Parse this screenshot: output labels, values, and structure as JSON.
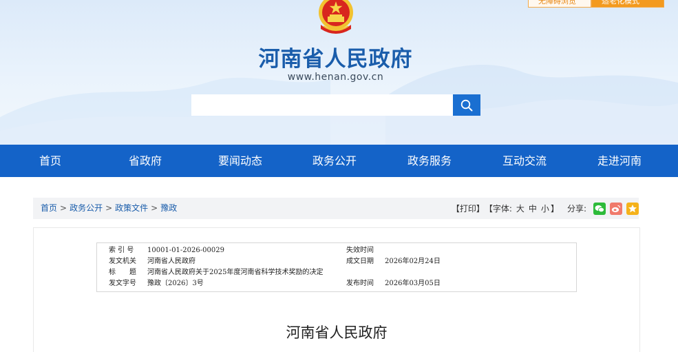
{
  "header": {
    "top_buttons": [
      "无障碍浏览",
      "适老化模式"
    ],
    "site_title": "河南省人民政府",
    "site_url": "www.henan.gov.cn",
    "search": {
      "placeholder": ""
    }
  },
  "nav": [
    "首页",
    "省政府",
    "要闻动态",
    "政务公开",
    "政务服务",
    "互动交流",
    "走进河南"
  ],
  "breadcrumb": {
    "items": [
      "首页",
      "政务公开",
      "政策文件",
      "豫政"
    ],
    "separator": ">"
  },
  "tools": {
    "print": "【打印】",
    "font_label": "【字体:",
    "font_large": "大",
    "font_medium": "中",
    "font_small": "小",
    "font_close": "】",
    "share_label": "分享:",
    "share_icons": [
      "wechat-icon",
      "weibo-icon",
      "favorite-icon"
    ]
  },
  "meta": {
    "index_label": "索 引 号",
    "index_value": "10001-01-2026-00029",
    "expire_label": "失效时间",
    "expire_value": "",
    "issuer_label": "发文机关",
    "issuer_value": "河南省人民政府",
    "created_label": "成文日期",
    "created_value": "2026年02月24日",
    "title_label": "标　　题",
    "title_value": "河南省人民政府关于2025年度河南省科学技术奖励的决定",
    "docno_label": "发文字号",
    "docno_value": "豫政〔2026〕3号",
    "published_label": "发布时间",
    "published_value": "2026年03月05日"
  },
  "document": {
    "heading": "河南省人民政府"
  },
  "colors": {
    "brand_blue": "#1463c8",
    "title_blue": "#1a5dab",
    "accent_orange": "#f39a1f",
    "wechat_green": "#2dbb3a",
    "weibo_pink": "#f07a6b",
    "favorite_yellow": "#f5b21a"
  }
}
